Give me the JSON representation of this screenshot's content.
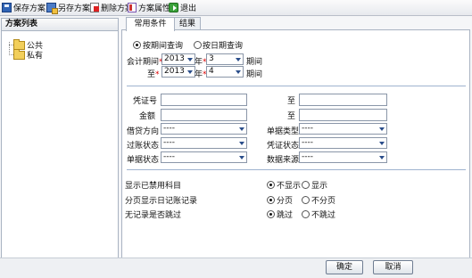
{
  "toolbar": {
    "save": "保存方案",
    "save_as": "另存方案",
    "delete": "删除方案",
    "properties": "方案属性",
    "exit": "退出"
  },
  "sidebar": {
    "title": "方案列表",
    "items": [
      {
        "label": "公共"
      },
      {
        "label": "私有"
      }
    ]
  },
  "tabs": [
    {
      "label": "常用条件"
    },
    {
      "label": "结果"
    }
  ],
  "query_mode": {
    "by_period": "按期间查询",
    "by_date": "按日期查询",
    "selected": "按期间查询"
  },
  "period": {
    "from_label": "会计期间",
    "to_label": "至",
    "from_year": "2013",
    "from_period": "3",
    "to_year": "2013",
    "to_period": "4",
    "year_unit": "年",
    "period_unit": "期间"
  },
  "fields": {
    "voucher_no": "凭证号",
    "to1": "至",
    "amount": "金额",
    "to2": "至",
    "direction": "借贷方向",
    "doc_type": "单据类型",
    "posting_status": "过账状态",
    "voucher_status": "凭证状态",
    "doc_status": "单据状态",
    "data_source": "数据来源",
    "empty_option": "----"
  },
  "options": {
    "show_disabled": "显示已禁用科目",
    "paging": "分页显示日记账记录",
    "skip_empty": "无记录是否跳过",
    "hide": "不显示",
    "show": "显示",
    "page": "分页",
    "no_page": "不分页",
    "skip": "跳过",
    "no_skip": "不跳过"
  },
  "buttons": {
    "ok": "确定",
    "cancel": "取消"
  }
}
